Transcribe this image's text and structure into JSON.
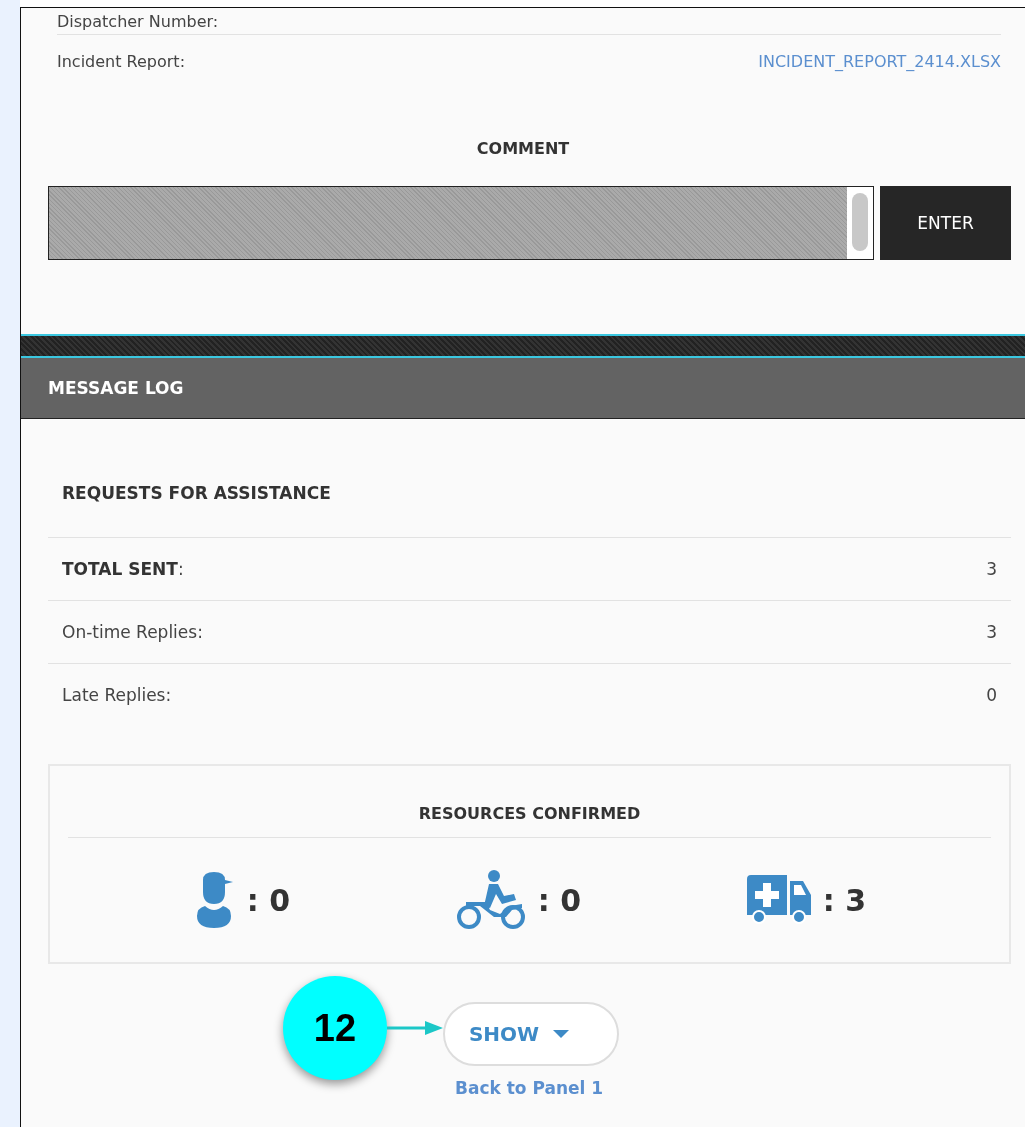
{
  "details": [
    {
      "label": "Dispatcher Number:"
    },
    {
      "label": "Incident Report:",
      "value": "INCIDENT_REPORT_2414.XLSX"
    }
  ],
  "comment": {
    "heading": "COMMENT",
    "button": "ENTER"
  },
  "message_log": {
    "title": "MESSAGE LOG"
  },
  "requests": {
    "heading": "REQUESTS FOR ASSISTANCE",
    "rows": [
      {
        "label": "TOTAL SENT",
        "suffix": ":",
        "value": "3",
        "bold": true
      },
      {
        "label": "On-time Replies:",
        "suffix": "",
        "value": "3",
        "bold": false
      },
      {
        "label": "Late Replies:",
        "suffix": "",
        "value": "0",
        "bold": false
      }
    ]
  },
  "resources": {
    "heading": "RESOURCES CONFIRMED",
    "items": [
      {
        "kind": "person",
        "count": ": 0"
      },
      {
        "kind": "motorcycle",
        "count": ": 0"
      },
      {
        "kind": "ambulance",
        "count": ": 3"
      }
    ]
  },
  "show_button": {
    "label": "SHOW"
  },
  "back_link": "Back to Panel 1",
  "callout": {
    "number": "12"
  }
}
